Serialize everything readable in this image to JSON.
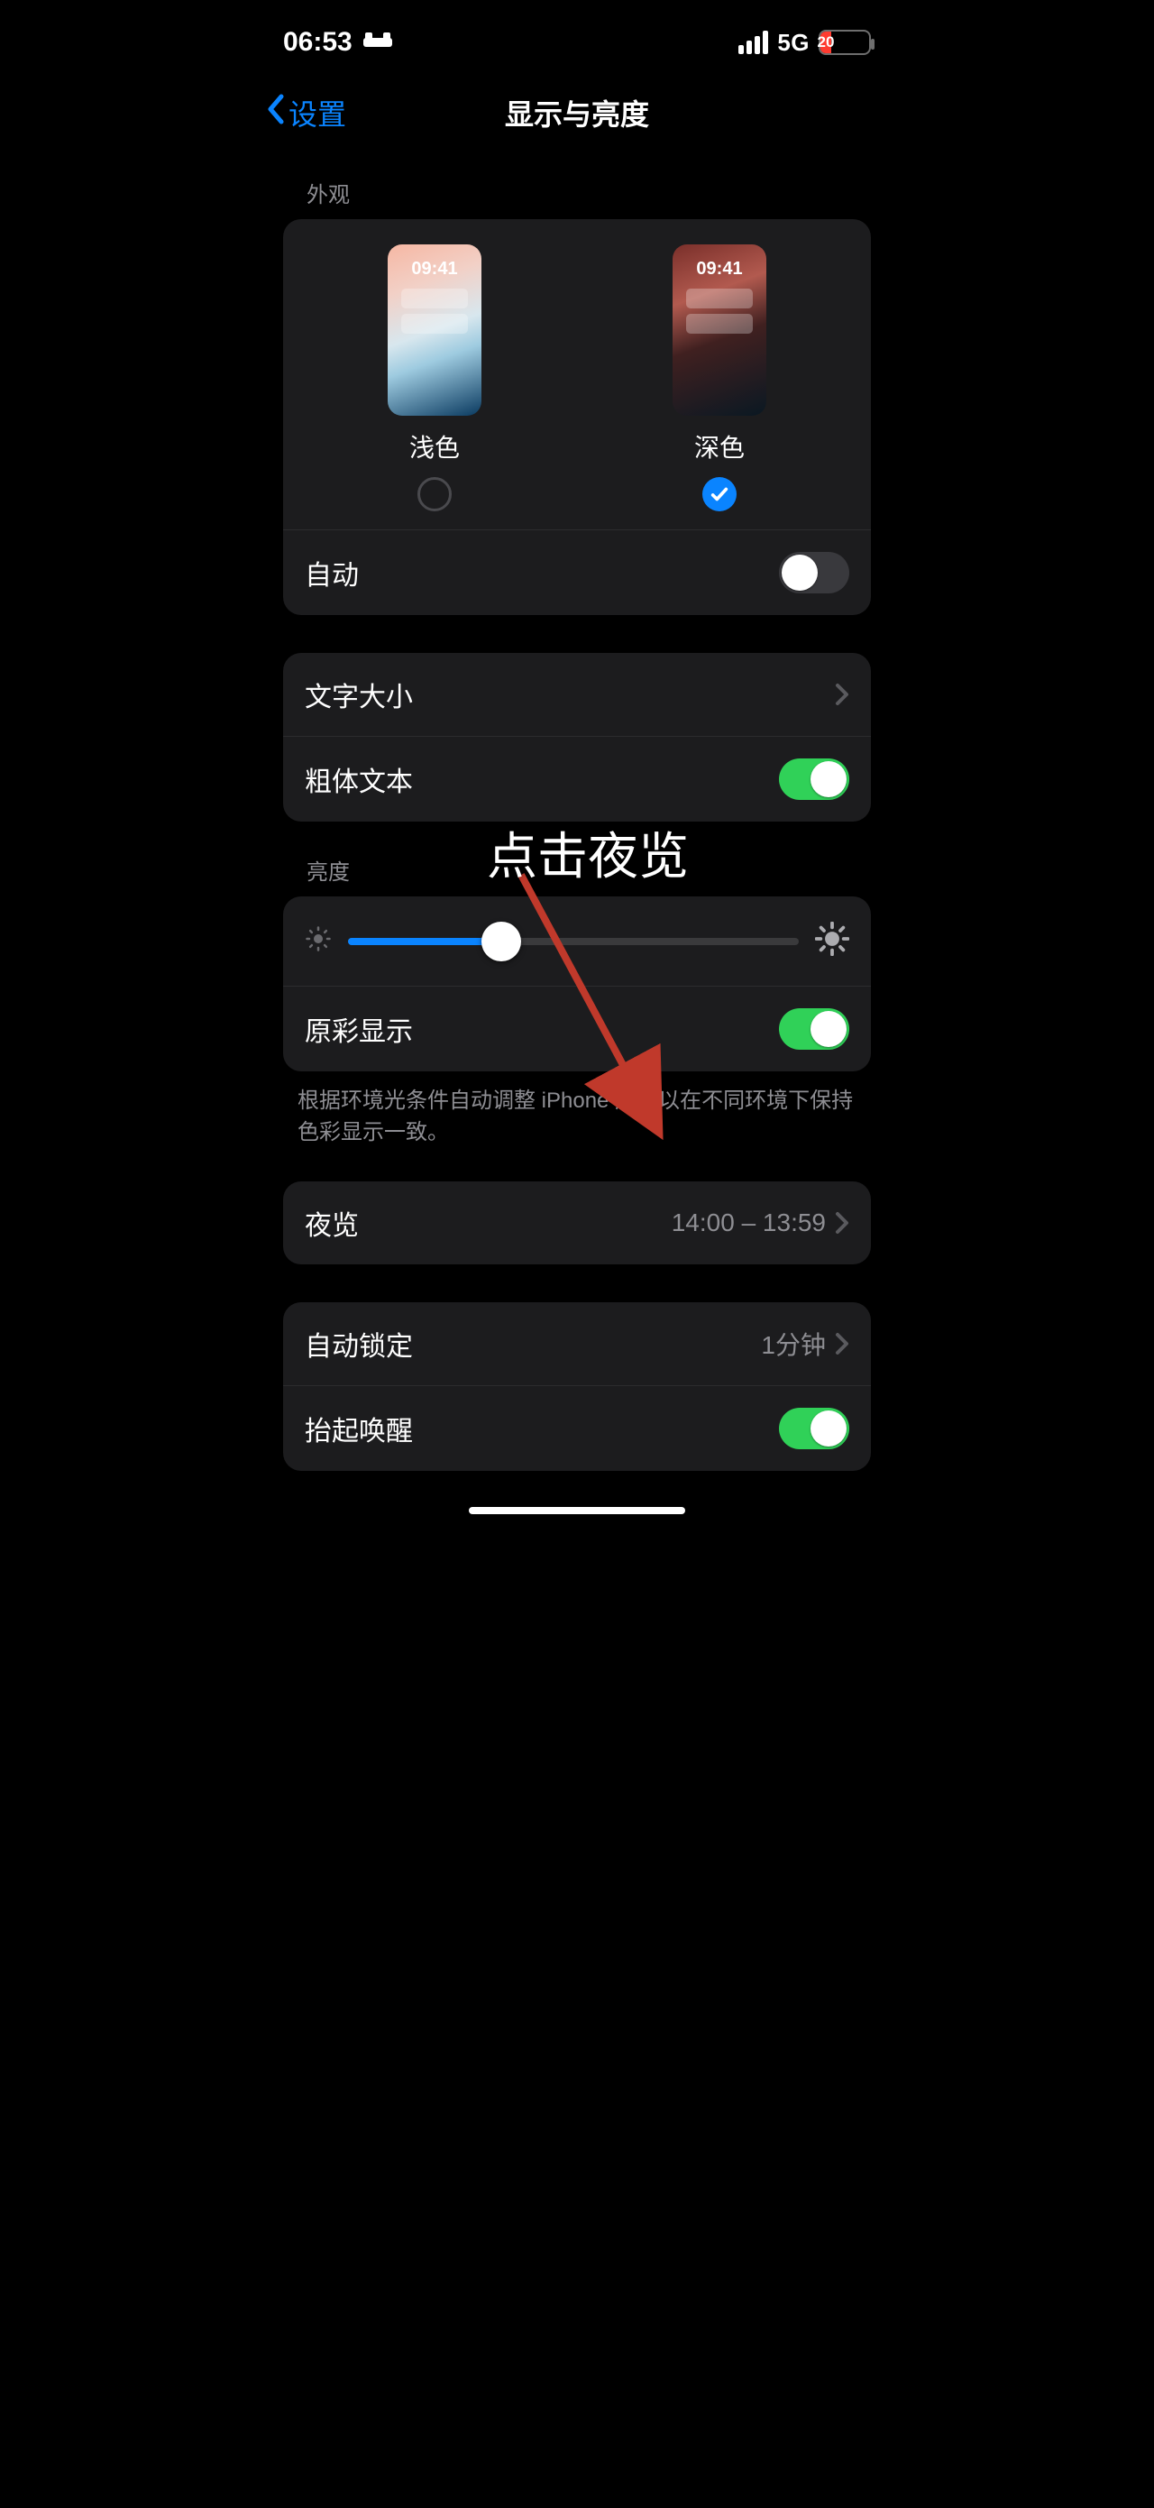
{
  "statusbar": {
    "time": "06:53",
    "network": "5G",
    "battery_percent": "20",
    "battery_fill_pct": 22
  },
  "nav": {
    "back_label": "设置",
    "title": "显示与亮度"
  },
  "appearance": {
    "header": "外观",
    "preview_time": "09:41",
    "light": {
      "label": "浅色",
      "selected": false
    },
    "dark": {
      "label": "深色",
      "selected": true
    },
    "auto": {
      "label": "自动",
      "on": false
    }
  },
  "text_group": {
    "text_size": "文字大小",
    "bold_text": {
      "label": "粗体文本",
      "on": true
    }
  },
  "brightness": {
    "header": "亮度",
    "slider_pct": 34,
    "true_tone": {
      "label": "原彩显示",
      "on": true
    },
    "footer": "根据环境光条件自动调整 iPhone 屏幕以在不同环境下保持色彩显示一致。"
  },
  "night_shift": {
    "label": "夜览",
    "value": "14:00 – 13:59"
  },
  "lock": {
    "auto_lock": {
      "label": "自动锁定",
      "value": "1分钟"
    },
    "raise_to_wake": {
      "label": "抬起唤醒",
      "on": true
    }
  },
  "annotation": {
    "text": "点击夜览"
  }
}
